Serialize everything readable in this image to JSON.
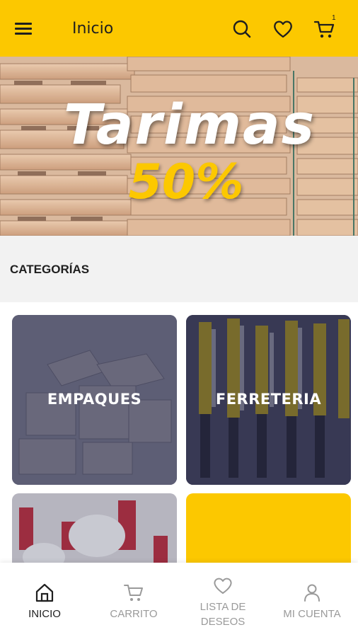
{
  "header": {
    "title": "Inicio",
    "cart_badge": "1",
    "background": "#fcc800"
  },
  "banner": {
    "title": "Tarimas",
    "subtitle": "50%"
  },
  "categories": {
    "heading": "CATEGORÍAS",
    "items": [
      {
        "label": "EMPAQUES"
      },
      {
        "label": "FERRETERIA"
      },
      {
        "label": ""
      },
      {
        "label": ""
      }
    ]
  },
  "bottom_nav": {
    "items": [
      {
        "label": "INICIO",
        "icon": "home-icon",
        "active": true
      },
      {
        "label": "CARRITO",
        "icon": "cart-icon",
        "active": false
      },
      {
        "label_line1": "LISTA DE",
        "label_line2": "DESEOS",
        "icon": "heart-icon",
        "active": false
      },
      {
        "label": "MI CUENTA",
        "icon": "user-icon",
        "active": false
      }
    ]
  },
  "colors": {
    "accent": "#fcc800",
    "text": "#1f1f1f",
    "muted": "#9a9a9a"
  }
}
